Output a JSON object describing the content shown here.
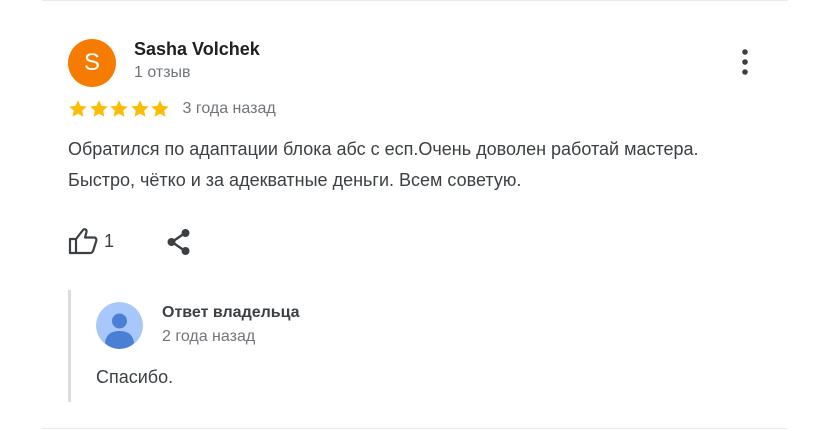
{
  "review": {
    "author": {
      "initial": "S",
      "name": "Sasha Volchek",
      "reviews_count": "1 отзыв",
      "avatar_color": "#f57c00"
    },
    "rating": 5,
    "max_rating": 5,
    "star_color": "#fbbc04",
    "date": "3 года назад",
    "text": "Обратился по адаптации блока абс с есп.Очень доволен работай мастера. Быстро, чётко и за адекватные деньги. Всем советую.",
    "likes": "1",
    "icons": {
      "more": "more-vertical-icon",
      "like": "thumb-up-icon",
      "share": "share-icon"
    }
  },
  "owner_reply": {
    "label": "Ответ владельца",
    "date": "2 года назад",
    "text": "Спасибо.",
    "avatar_icon": "person-avatar-icon",
    "avatar_color": "#a8c7fa",
    "avatar_figure_color": "#4a7fd6"
  }
}
